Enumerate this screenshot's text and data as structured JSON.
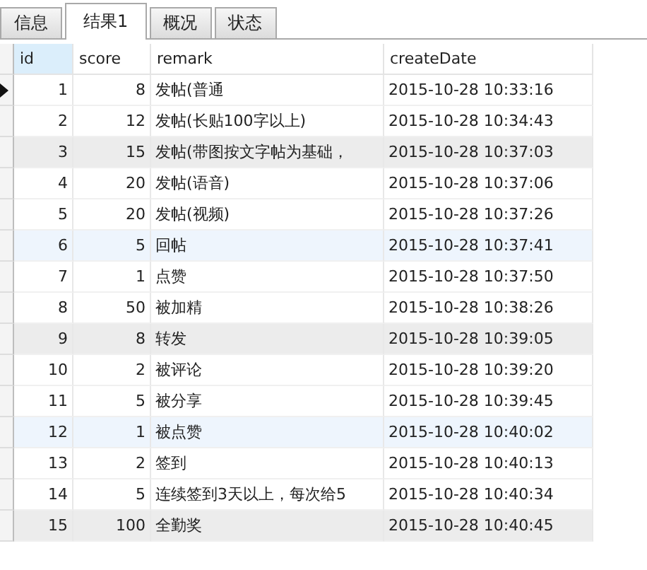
{
  "tabs": [
    {
      "label": "信息",
      "selected": false
    },
    {
      "label": "结果1",
      "selected": true
    },
    {
      "label": "概况",
      "selected": false
    },
    {
      "label": "状态",
      "selected": false
    }
  ],
  "table": {
    "columns": [
      "id",
      "score",
      "remark",
      "createDate"
    ],
    "rows": [
      {
        "id": "1",
        "score": "8",
        "remark": "发帖(普通",
        "createDate": "2015-10-28 10:33:16",
        "current": true,
        "color": "#ffffff"
      },
      {
        "id": "2",
        "score": "12",
        "remark": "发帖(长贴100字以上)",
        "createDate": "2015-10-28 10:34:43",
        "current": false,
        "color": "#ffffff"
      },
      {
        "id": "3",
        "score": "15",
        "remark": "发帖(带图按文字帖为基础，",
        "createDate": "2015-10-28 10:37:03",
        "current": false,
        "color": "#ececec"
      },
      {
        "id": "4",
        "score": "20",
        "remark": "发帖(语音)",
        "createDate": "2015-10-28 10:37:06",
        "current": false,
        "color": "#ffffff"
      },
      {
        "id": "5",
        "score": "20",
        "remark": "发帖(视频)",
        "createDate": "2015-10-28 10:37:26",
        "current": false,
        "color": "#ffffff"
      },
      {
        "id": "6",
        "score": "5",
        "remark": "回帖",
        "createDate": "2015-10-28 10:37:41",
        "current": false,
        "color": "#eef5fd"
      },
      {
        "id": "7",
        "score": "1",
        "remark": "点赞",
        "createDate": "2015-10-28 10:37:50",
        "current": false,
        "color": "#ffffff"
      },
      {
        "id": "8",
        "score": "50",
        "remark": "被加精",
        "createDate": "2015-10-28 10:38:26",
        "current": false,
        "color": "#ffffff"
      },
      {
        "id": "9",
        "score": "8",
        "remark": "转发",
        "createDate": "2015-10-28 10:39:05",
        "current": false,
        "color": "#ececec"
      },
      {
        "id": "10",
        "score": "2",
        "remark": "被评论",
        "createDate": "2015-10-28 10:39:20",
        "current": false,
        "color": "#ffffff"
      },
      {
        "id": "11",
        "score": "5",
        "remark": "被分享",
        "createDate": "2015-10-28 10:39:45",
        "current": false,
        "color": "#ffffff"
      },
      {
        "id": "12",
        "score": "1",
        "remark": "被点赞",
        "createDate": "2015-10-28 10:40:02",
        "current": false,
        "color": "#eef5fd"
      },
      {
        "id": "13",
        "score": "2",
        "remark": "签到",
        "createDate": "2015-10-28 10:40:13",
        "current": false,
        "color": "#ffffff"
      },
      {
        "id": "14",
        "score": "5",
        "remark": "连续签到3天以上，每次给5",
        "createDate": "2015-10-28 10:40:34",
        "current": false,
        "color": "#ffffff"
      },
      {
        "id": "15",
        "score": "100",
        "remark": "全勤奖",
        "createDate": "2015-10-28 10:40:45",
        "current": false,
        "color": "#ececec"
      }
    ]
  }
}
